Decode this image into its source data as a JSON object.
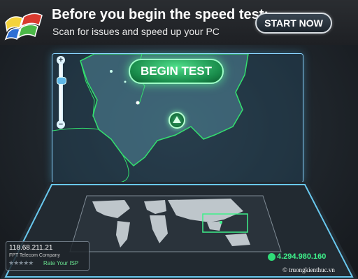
{
  "banner": {
    "title": "Before you begin the speed test:",
    "subtitle": "Scan for issues and speed up your PC",
    "start_label": "START NOW"
  },
  "map": {
    "begin_label": "BEGIN TEST",
    "zoom_in_symbol": "+",
    "zoom_out_symbol": "−"
  },
  "client": {
    "ip": "118.68.211.21",
    "isp": "FPT Telecom Company",
    "rating_stars": "★★★★★",
    "rate_label": "Rate Your ISP"
  },
  "stats": {
    "tests_count": "4.294.980.160"
  },
  "watermark": "© truongkienthuc.vn",
  "colors": {
    "accent_green": "#3ef08a",
    "panel_glow": "#8ad3ff",
    "background": "#1b1e22"
  },
  "icons": [
    "windows-logo-icon",
    "map-pin-icon",
    "world-map-icon",
    "counter-icon"
  ]
}
